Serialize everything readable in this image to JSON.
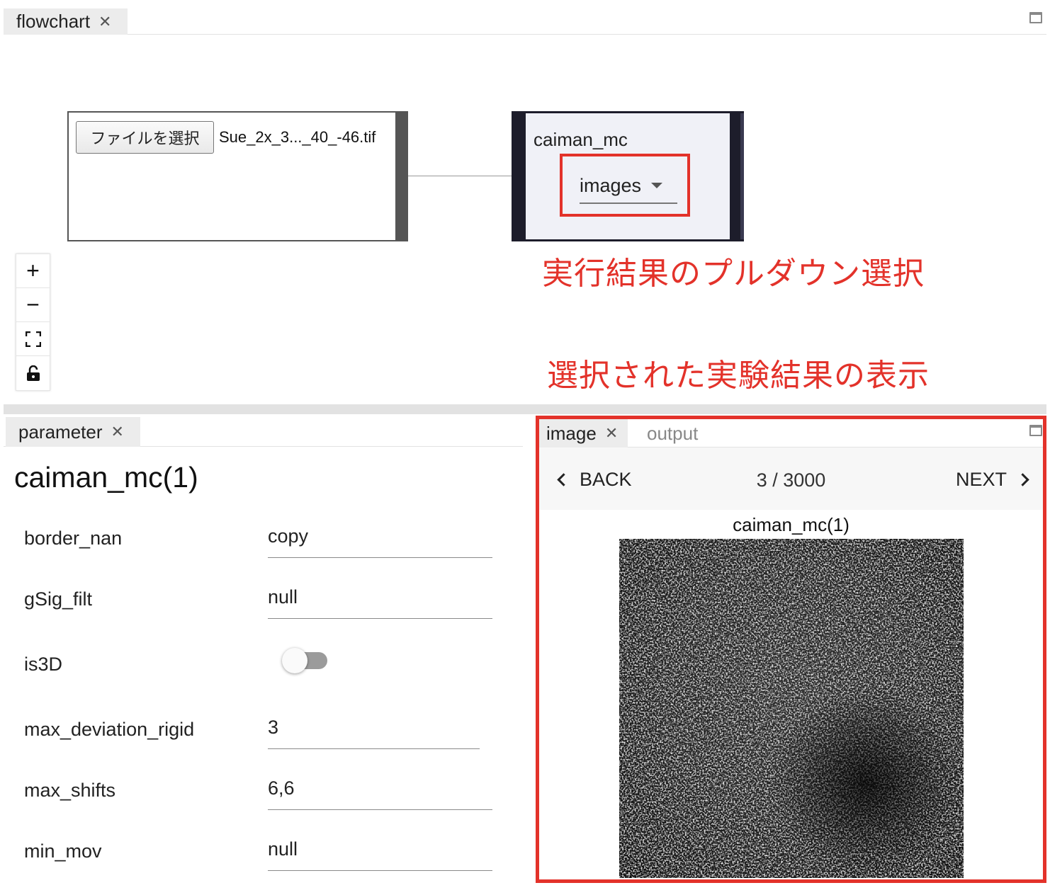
{
  "flowchart_panel": {
    "tab_label": "flowchart",
    "close_glyph": "✕",
    "maximize_icon": "maximize-icon"
  },
  "file_node": {
    "button_label": "ファイルを選択",
    "file_name": "Sue_2x_3..._40_-46.tif"
  },
  "algo_node": {
    "title": "caiman_mc",
    "select_value": "images"
  },
  "annotations": {
    "dropdown_note": "実行結果のプルダウン選択",
    "display_note": "選択された実験結果の表示",
    "highlight_color": "#e3322a"
  },
  "zoom_controls": {
    "zoom_in": "+",
    "zoom_out": "−",
    "fit_view": "fit-view-icon",
    "lock": "lock-icon"
  },
  "parameter_panel": {
    "tab_label": "parameter",
    "title": "caiman_mc(1)",
    "params": [
      {
        "label": "border_nan",
        "value": "copy"
      },
      {
        "label": "gSig_filt",
        "value": "null"
      },
      {
        "label": "is3D",
        "value": "false"
      },
      {
        "label": "max_deviation_rigid",
        "value": "3"
      },
      {
        "label": "max_shifts",
        "value": "6,6"
      },
      {
        "label": "min_mov",
        "value": "null"
      }
    ]
  },
  "image_panel": {
    "tabs": [
      {
        "label": "image",
        "active": true
      },
      {
        "label": "output",
        "active": false
      }
    ],
    "back_label": "BACK",
    "next_label": "NEXT",
    "page_counter": "3 / 3000",
    "plot_title": "caiman_mc(1)"
  }
}
